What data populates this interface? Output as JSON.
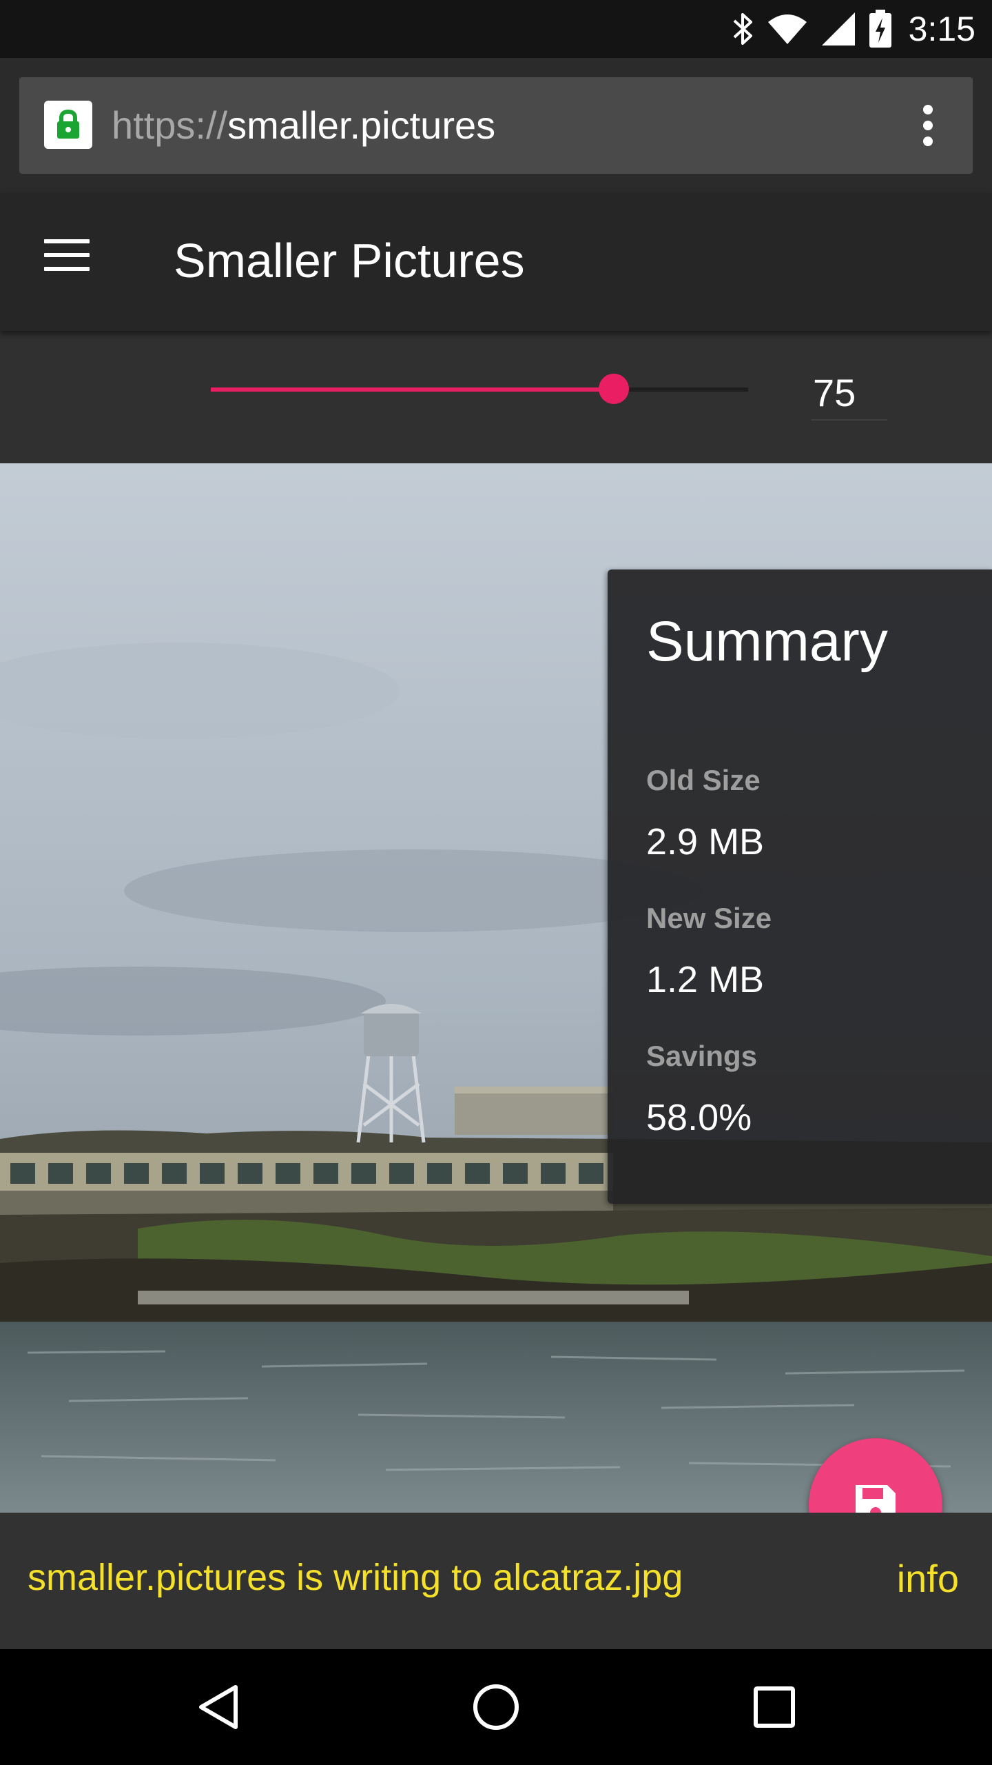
{
  "status_bar": {
    "time": "3:15",
    "icons": [
      "bluetooth-icon",
      "wifi-icon",
      "cellular-signal-icon",
      "battery-charging-icon"
    ]
  },
  "browser": {
    "url_scheme": "https://",
    "url_host": "smaller.pictures",
    "lock_color": "#1aa532",
    "menu_icon": "more-vertical-icon"
  },
  "app_bar": {
    "menu_icon": "hamburger-menu-icon",
    "title": "Smaller Pictures"
  },
  "quality": {
    "value": "75",
    "slider_fraction": 0.75,
    "accent_color": "#e91e63"
  },
  "summary": {
    "title": "Summary",
    "old_size_label": "Old Size",
    "old_size_value": "2.9 MB",
    "new_size_label": "New Size",
    "new_size_value": "1.2 MB",
    "savings_label": "Savings",
    "savings_value": "58.0%"
  },
  "fab": {
    "icon": "save-floppy-icon",
    "color": "#ef3f7c"
  },
  "snackbar": {
    "message": "smaller.pictures is writing to alcatraz.jpg",
    "action": "info",
    "text_color": "#f5e12a"
  },
  "nav_bar": {
    "icons": [
      "back-triangle-icon",
      "home-circle-icon",
      "recents-square-icon"
    ]
  }
}
